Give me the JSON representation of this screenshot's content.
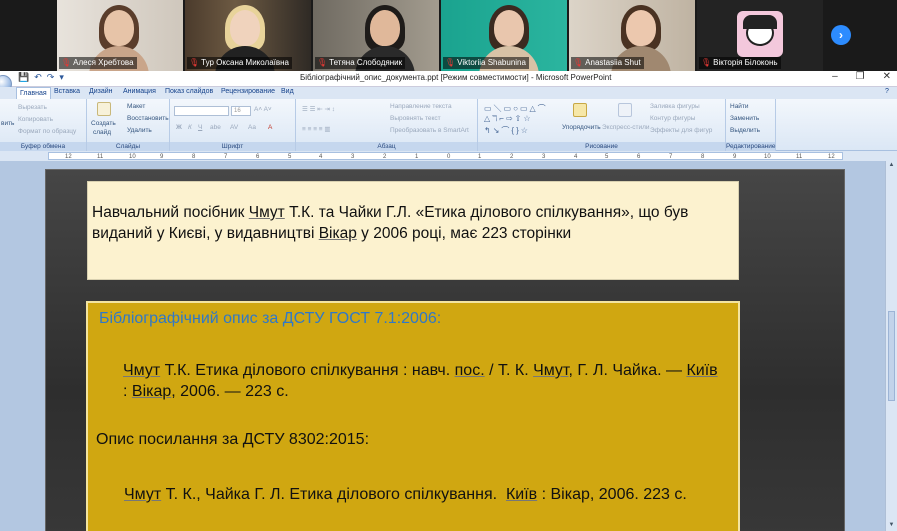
{
  "participants": [
    {
      "name": "Алеся Хребтова",
      "mic_muted": true,
      "active": false
    },
    {
      "name": "Тур Оксана Миколаївна",
      "mic_muted": true,
      "active": false
    },
    {
      "name": "Тетяна Слободяник",
      "mic_muted": true,
      "active": true
    },
    {
      "name": "Viktoriia Shabunina",
      "mic_muted": true,
      "active": false
    },
    {
      "name": "Anastasiia Shut",
      "mic_muted": true,
      "active": false
    },
    {
      "name": "Вікторія Білоконь",
      "mic_muted": true,
      "active": false
    }
  ],
  "next_page_icon": "chevron-right-icon",
  "window": {
    "title": "Бібліографічний_опис_документа.ppt [Режим совместимости] - Microsoft PowerPoint",
    "controls": [
      "–",
      "❐",
      "✕"
    ]
  },
  "tabs": [
    "Главная",
    "Вставка",
    "Дизайн",
    "Анимация",
    "Показ слайдов",
    "Рецензирование",
    "Вид"
  ],
  "selected_tab": "Главная",
  "ribbon": {
    "clipboard": {
      "paste": "вить",
      "cut": "Вырезать",
      "copy": "Копировать",
      "format_painter": "Формат по образцу",
      "label": "Буфер обмена"
    },
    "slides": {
      "new_slide": "Создать",
      "new_slide2": "слайд",
      "layout": "Макет",
      "reset": "Восстановить",
      "delete": "Удалить",
      "label": "Слайды"
    },
    "font": {
      "label": "Шрифт",
      "size": "16"
    },
    "paragraph": {
      "text_direction": "Направление текста",
      "align_text": "Выровнять текст",
      "smartart": "Преобразовать в SmartArt",
      "label": "Абзац"
    },
    "drawing": {
      "arrange": "Упорядочить",
      "quick_styles": "Экспресс-стили",
      "shape_fill": "Заливка фигуры",
      "shape_outline": "Контур фигуры",
      "shape_effects": "Эффекты для фигур",
      "label": "Рисование"
    },
    "editing": {
      "find": "Найти",
      "replace": "Заменить",
      "select": "Выделить",
      "label": "Редактирование"
    }
  },
  "ruler_ticks": [
    "12",
    "11",
    "10",
    "9",
    "8",
    "7",
    "6",
    "5",
    "4",
    "3",
    "2",
    "1",
    "0",
    "1",
    "2",
    "3",
    "4",
    "5",
    "6",
    "7",
    "8",
    "9",
    "10",
    "11",
    "12"
  ],
  "slide": {
    "task_text": "Навчальний посібник Чмут Т.К. та Чайки Г.Л. «Етика ділового спілкування», що був виданий у Києві, у видавництві Вікар у 2006 році, має 223 сторінки",
    "heading1": "Бібліографічний опис за ДСТУ ГОСТ 7.1:2006:",
    "entry1": "Чмут Т.К. Етика ділового спілкування : навч. пос. / Т. К. Чмут, Г. Л. Чайка. — Київ : Вікар, 2006. — 223 с.",
    "heading2": "Опис посилання за ДСТУ 8302:2015:",
    "entry2": "Чмут Т. К., Чайка Г. Л. Етика ділового спілкування.  Київ : Вікар, 2006. 223 с."
  },
  "colors": {
    "task_box": "#fcf2cf",
    "answer_box": "#d0a711",
    "heading_blue": "#2f78c8",
    "zoom_blue": "#2d8cff",
    "active_speaker": "#3fd13f"
  }
}
